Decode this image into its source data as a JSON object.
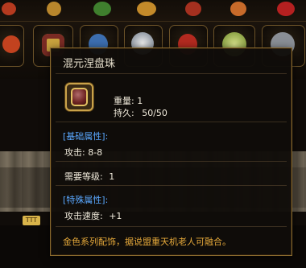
{
  "tooltip": {
    "title": "混元涅盘珠",
    "stats": {
      "weight_label": "重量:",
      "weight_value": "1",
      "durability_label": "持久:",
      "durability_value": "50/50"
    },
    "basic_header": "[基础属性]:",
    "attack_label": "攻击:",
    "attack_value": "8-8",
    "level_label": "需要等级:",
    "level_value": "1",
    "special_header": "[特殊属性]:",
    "attack_speed_label": "攻击速度:",
    "attack_speed_value": "+1",
    "description": "金色系列配饰，据说盟重天机老人可融合。"
  },
  "background": {
    "badge_text": "TTT"
  },
  "colors": {
    "title": "#e9e2cf",
    "header": "#5aa8ff",
    "description": "#e6a93a",
    "border": "#8a6a2e"
  }
}
